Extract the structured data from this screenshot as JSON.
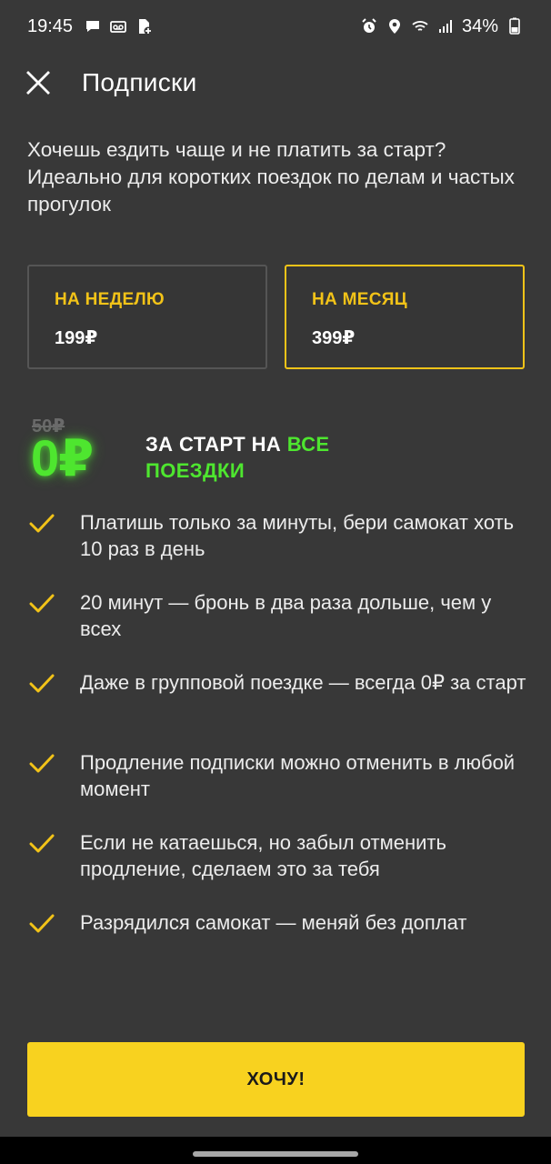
{
  "status_bar": {
    "time": "19:45",
    "battery": "34%",
    "left_icons": [
      "message-icon",
      "voicemail-icon",
      "sim-add-icon"
    ],
    "right_icons": [
      "alarm-icon",
      "location-icon",
      "wifi-icon",
      "signal-icon",
      "battery-icon"
    ]
  },
  "header": {
    "title": "Подписки",
    "close_icon": "close-icon"
  },
  "intro": "Хочешь ездить чаще и не платить за старт? Идеально для коротких поездок по делам и частых прогулок",
  "plans": [
    {
      "name": "НА НЕДЕЛЮ",
      "price": "199₽",
      "selected": false
    },
    {
      "name": "НА МЕСЯЦ",
      "price": "399₽",
      "selected": true
    }
  ],
  "promo": {
    "old_price": "50₽",
    "price": "0₽",
    "text_white": "ЗА СТАРТ НА ",
    "text_green": "ВСЕ ПОЕЗДКИ"
  },
  "features": [
    "Платишь только за минуты, бери самокат хоть 10 раз в день",
    "20 минут — бронь в два раза дольше, чем у всех",
    "Даже в групповой поездке — всегда 0₽ за старт",
    "Продление подписки можно отменить в любой момент",
    "Если не катаешься, но забыл отменить продление, сделаем это за тебя",
    "Разрядился самокат — меняй без доплат"
  ],
  "cta": {
    "label": "ХОЧУ!"
  },
  "colors": {
    "background": "#383838",
    "accent_yellow": "#f2c318",
    "button_yellow": "#f8d21f",
    "neon_green": "#4ee62f"
  }
}
